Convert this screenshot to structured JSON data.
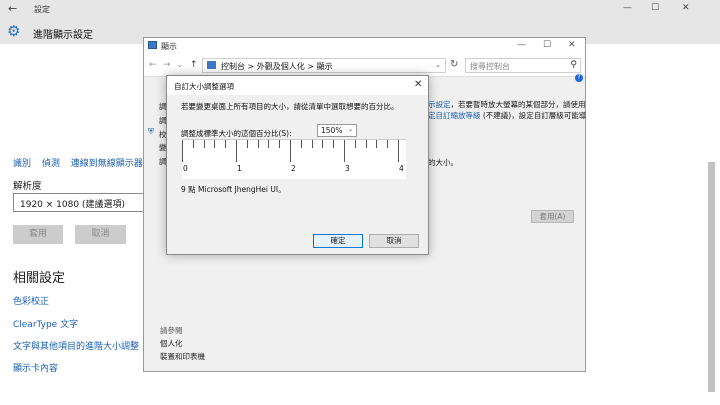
{
  "settings": {
    "window_title": "設定",
    "header": "進階顯示設定",
    "links": [
      "識別",
      "偵測",
      "連線到無線顯示器"
    ],
    "resolution_label": "解析度",
    "resolution_value": "1920 × 1080 (建議選項)",
    "apply_label": "套用",
    "cancel_label": "取消",
    "related_title": "相關設定",
    "related": [
      "色彩校正",
      "ClearType 文字",
      "文字與其他項目的進階大小調整",
      "顯示卡內容"
    ]
  },
  "control_panel": {
    "title": "顯示",
    "breadcrumb": "控制台 > 外觀及個人化 > 顯示",
    "search_placeholder": "搜尋控制台",
    "side_text": [
      "調",
      "調",
      "校",
      "變",
      "調"
    ],
    "text_line1a": "示設定",
    "text_line1b": "，若要暫時放大螢幕的某個部分，請使用",
    "text_line2a": "定自訂縮放等級",
    "text_line2b": " (不建議)，設定自訂層級可能導",
    "text_line3": "的大小。",
    "apply_label": "套用(A)",
    "see_also": "請參閱",
    "see_links": [
      "個人化",
      "裝置和印表機"
    ]
  },
  "dialog": {
    "title": "自訂大小調整選項",
    "description": "若要變更桌面上所有項目的大小，請從清單中選取想要的百分比。",
    "percent_label": "調整成標準大小的這個百分比(S):",
    "percent_value": "150%",
    "ruler_labels": [
      "0",
      "1",
      "2",
      "3",
      "4"
    ],
    "sample": "9 點 Microsoft JhengHei UI。",
    "ok_label": "確定",
    "cancel_label": "取消"
  },
  "icons": {
    "settings_gear": "gear-icon",
    "back": "back-arrow-icon",
    "search": "search-icon",
    "refresh": "refresh-icon",
    "help": "help-icon",
    "shield": "shield-icon",
    "close": "close-icon"
  },
  "colors": {
    "link": "#1a5fb4",
    "accent": "#0078d7",
    "titlebar": "#e6e6e6"
  }
}
